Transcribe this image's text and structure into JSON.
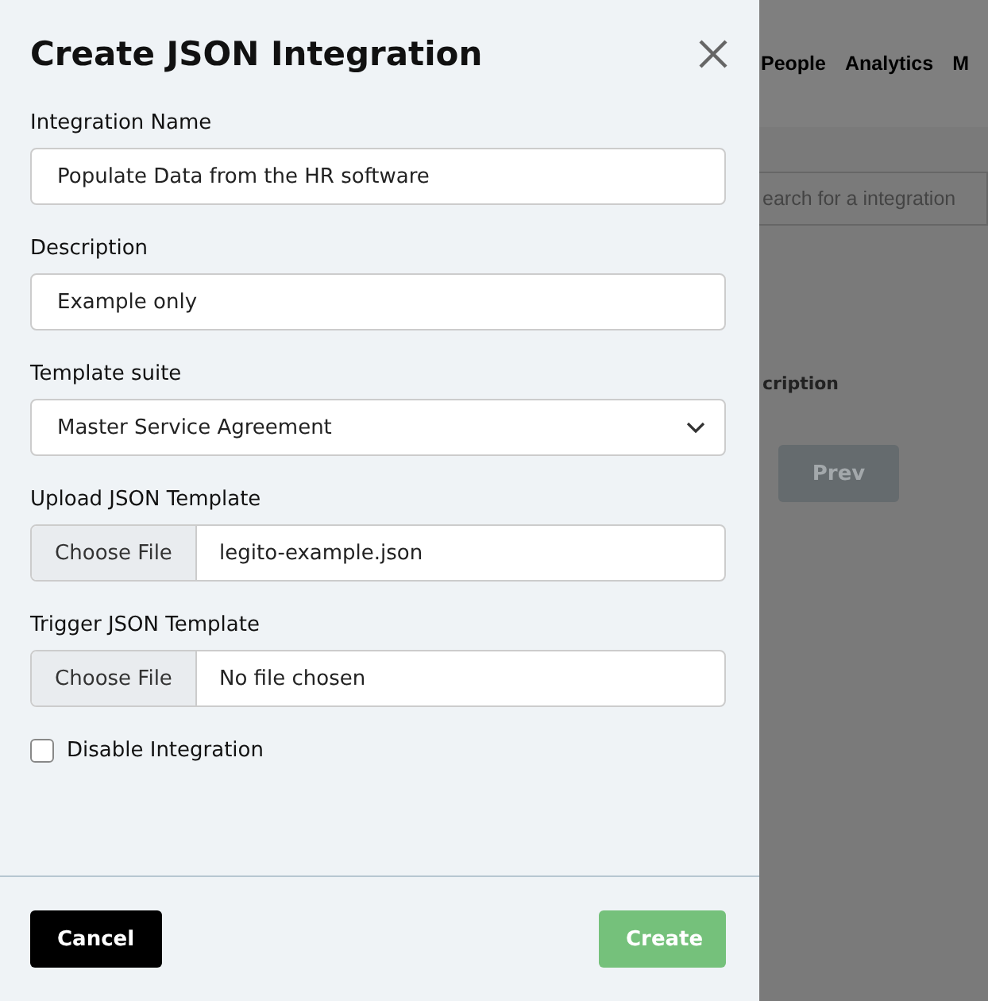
{
  "background_page": {
    "nav_items": [
      "People",
      "Analytics",
      "M"
    ],
    "search": {
      "placeholder": "earch for a integration"
    },
    "column_header": "cription",
    "prev_button": {
      "label": "Prev",
      "disabled": true
    }
  },
  "dialog": {
    "title": "Create JSON Integration",
    "fields": [
      {
        "kind": "text",
        "label": "Integration Name",
        "value": "Populate Data from the HR software"
      },
      {
        "kind": "text",
        "label": "Description",
        "value": "Example only"
      },
      {
        "kind": "select",
        "label": "Template suite",
        "value": "Master Service Agreement"
      },
      {
        "kind": "file",
        "label": "Upload JSON Template",
        "button": "Choose File",
        "value": "legito-example.json"
      },
      {
        "kind": "file",
        "label": "Trigger JSON Template",
        "button": "Choose File",
        "value": "No file chosen"
      },
      {
        "kind": "checkbox",
        "label": "Disable Integration",
        "checked": false
      }
    ],
    "cancel_button": {
      "label": "Cancel"
    },
    "create_button": {
      "label": "Create",
      "disabled": true
    }
  }
}
